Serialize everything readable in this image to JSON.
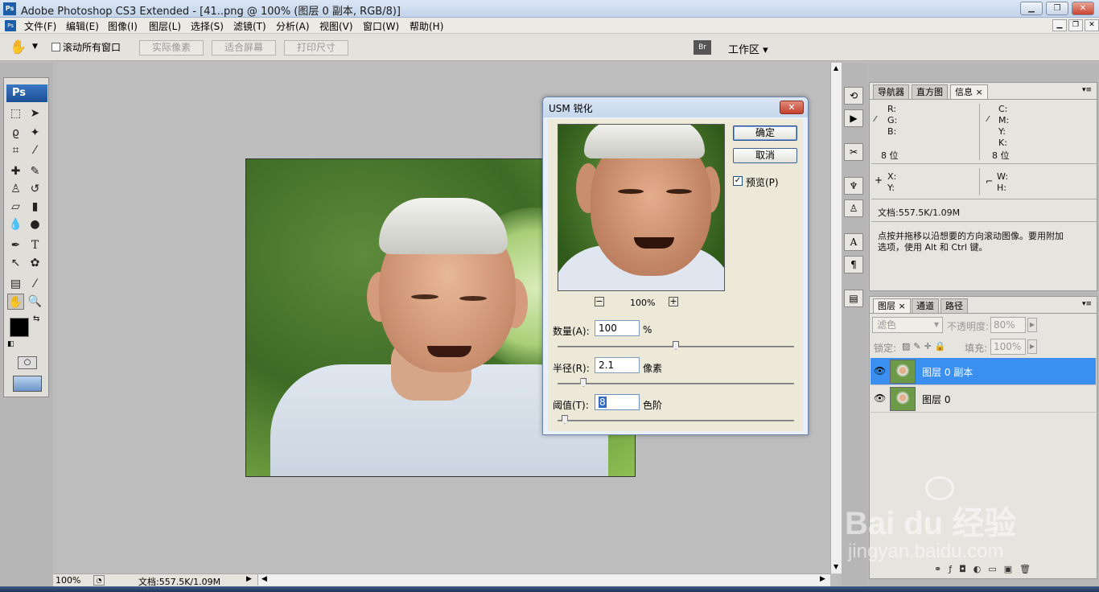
{
  "window": {
    "title": "Adobe Photoshop CS3 Extended - [41..png @ 100% (图层 0 副本, RGB/8)]"
  },
  "menu": [
    "文件(F)",
    "编辑(E)",
    "图像(I)",
    "图层(L)",
    "选择(S)",
    "滤镜(T)",
    "分析(A)",
    "视图(V)",
    "窗口(W)",
    "帮助(H)"
  ],
  "options": {
    "scroll_all": "滚动所有窗口",
    "actual_pixels": "实际像素",
    "fit_screen": "适合屏幕",
    "print_size": "打印尺寸",
    "workspace": "工作区 ▾"
  },
  "dialog": {
    "title": "USM 锐化",
    "ok": "确定",
    "cancel": "取消",
    "preview_label": "预览(P)",
    "preview_checked": true,
    "zoom": "100%",
    "zoom_minus": "−",
    "zoom_plus": "+",
    "amount": {
      "label": "数量(A):",
      "value": "100",
      "unit": "%",
      "fraction": 0.5
    },
    "radius": {
      "label": "半径(R):",
      "value": "2.1",
      "unit": "像素",
      "fraction": 0.11
    },
    "threshold": {
      "label": "阈值(T):",
      "value": "8",
      "unit": "色阶",
      "fraction": 0.03
    }
  },
  "status": {
    "zoom": "100%",
    "doc": "文档:557.5K/1.09M"
  },
  "info_panel": {
    "tabs": [
      "导航器",
      "直方图",
      "信息 ×"
    ],
    "r": "R:",
    "g": "G:",
    "b": "B:",
    "c": "C:",
    "m": "M:",
    "y": "Y:",
    "k": "K:",
    "bits_left": "8 位",
    "bits_right": "8 位",
    "x": "X:",
    "yc": "Y:",
    "w": "W:",
    "h": "H:",
    "doc": "文档:557.5K/1.09M",
    "hint_line1": "点按并拖移以沿想要的方向滚动图像。要用附加",
    "hint_line2": "选项，使用 Alt 和 Ctrl 键。"
  },
  "layers_panel": {
    "tabs": [
      "图层 ×",
      "通道",
      "路径"
    ],
    "blend_mode": "滤色",
    "opacity_label": "不透明度:",
    "opacity": "80%",
    "lock_label": "锁定:",
    "fill_label": "填充:",
    "fill": "100%",
    "layers": [
      {
        "name": "图层 0 副本",
        "selected": true
      },
      {
        "name": "图层 0",
        "selected": false
      }
    ]
  },
  "watermark": {
    "brand": "Bai du 经验",
    "url": "jingyan.baidu.com"
  }
}
